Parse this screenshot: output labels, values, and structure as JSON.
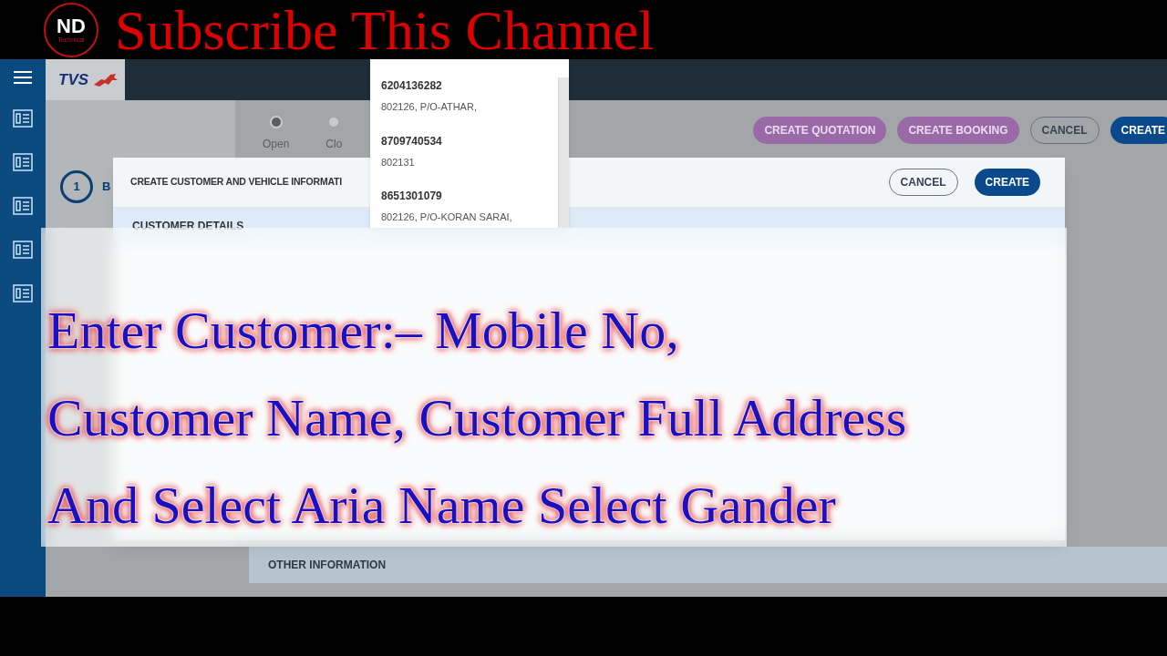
{
  "banner": {
    "logo_text": "ND",
    "logo_subtext": "Technical",
    "title": "Subscribe This Channel"
  },
  "app": {
    "brand": "TVS",
    "stepper": [
      {
        "label": "Open",
        "selected": true
      },
      {
        "label": "Clo",
        "selected": false
      }
    ],
    "toolbar_buttons": [
      {
        "label": "CREATE QUOTATION",
        "kind": "accent"
      },
      {
        "label": "CREATE BOOKING",
        "kind": "accent"
      },
      {
        "label": "CANCEL",
        "kind": "outline"
      },
      {
        "label": "CREATE",
        "kind": "primary"
      }
    ],
    "side_step": {
      "number": "1",
      "label": "B"
    },
    "dialog": {
      "title": "CREATE CUSTOMER AND VEHICLE INFORMATI",
      "buttons": [
        {
          "label": "CANCEL",
          "kind": "outline"
        },
        {
          "label": "CREATE",
          "kind": "primary"
        }
      ],
      "section": "CUSTOMER DETAILS"
    },
    "dropdown": [
      {
        "phone": "6204136282",
        "address": "802126, P/O-ATHAR,"
      },
      {
        "phone": "8709740534",
        "address": "802131"
      },
      {
        "phone": "8651301079",
        "address": "802126, P/O-KORAN SARAI,"
      }
    ],
    "other_section": "OTHER INFORMATION"
  },
  "caption": [
    "Enter Customer:– Mobile No,",
    "Customer Name, Customer Full Address",
    "And Select Aria Name Select Gander"
  ]
}
